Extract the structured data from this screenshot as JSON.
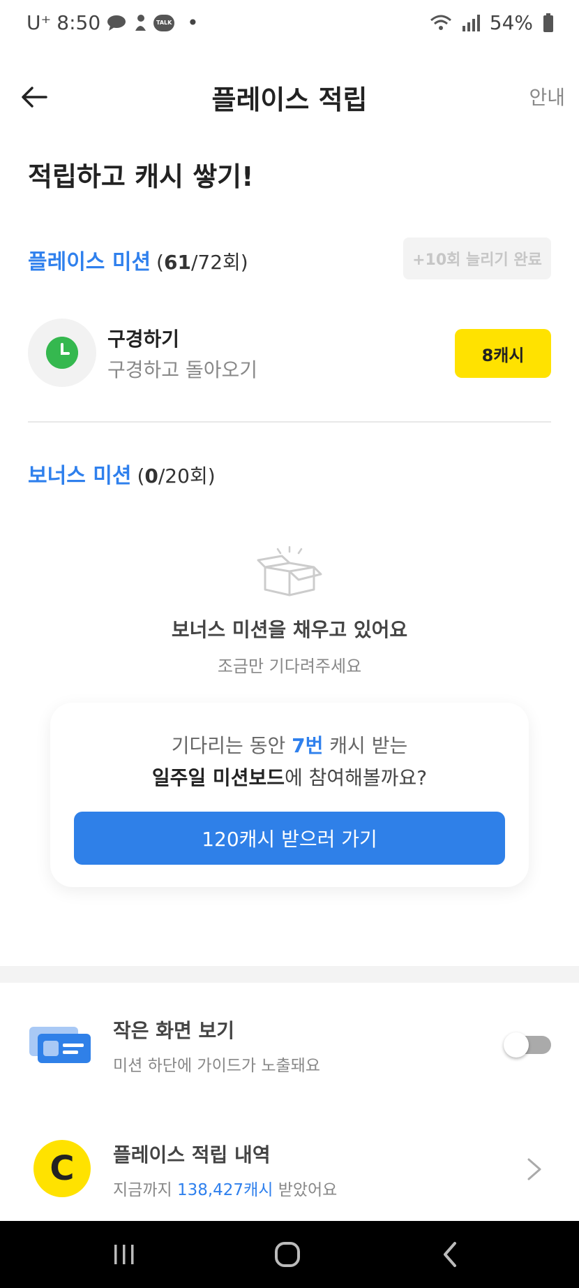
{
  "status_bar": {
    "carrier": "U⁺",
    "time": "8:50",
    "talk_label": "TALK",
    "dot": "•",
    "battery": "54%"
  },
  "header": {
    "title": "플레이스 적립",
    "guide_label": "안내"
  },
  "headline": "적립하고 캐시 쌓기!",
  "place_mission": {
    "title": "플레이스 미션",
    "count_open": "(",
    "count_done": "61",
    "count_rest": "/72회)",
    "extend_label": "+10회 늘리기 완료",
    "item": {
      "name": "구경하기",
      "desc": "구경하고 돌아오기",
      "reward_label": "8캐시"
    }
  },
  "bonus_mission": {
    "title": "보너스 미션",
    "count_open": "(",
    "count_done": "0",
    "count_rest": "/20회)",
    "empty_title": "보너스 미션을 채우고 있어요",
    "empty_sub": "조금만 기다려주세요"
  },
  "promo_card": {
    "line1_a": "기다리는 동안 ",
    "line1_hl": "7번",
    "line1_b": " 캐시 받는",
    "line2_bold": "일주일 미션보드",
    "line2_rest": "에 참여해볼까요?",
    "button_label": "120캐시 받으러 가기"
  },
  "small_view": {
    "title": "작은 화면 보기",
    "desc": "미션 하단에 가이드가 노출돼요",
    "enabled": false
  },
  "history": {
    "icon_letter": "C",
    "title": "플레이스 적립 내역",
    "desc_a": "지금까지 ",
    "desc_hl": "138,427캐시",
    "desc_b": " 받았어요"
  },
  "colors": {
    "accent_blue": "#2f80ed",
    "cash_yellow": "#ffe200",
    "clock_green": "#35b84f"
  },
  "icons": [
    "back-arrow-icon",
    "clock-icon",
    "empty-box-icon",
    "card-view-icon",
    "chevron-right-icon",
    "recent-apps-icon",
    "home-icon",
    "nav-back-icon"
  ]
}
